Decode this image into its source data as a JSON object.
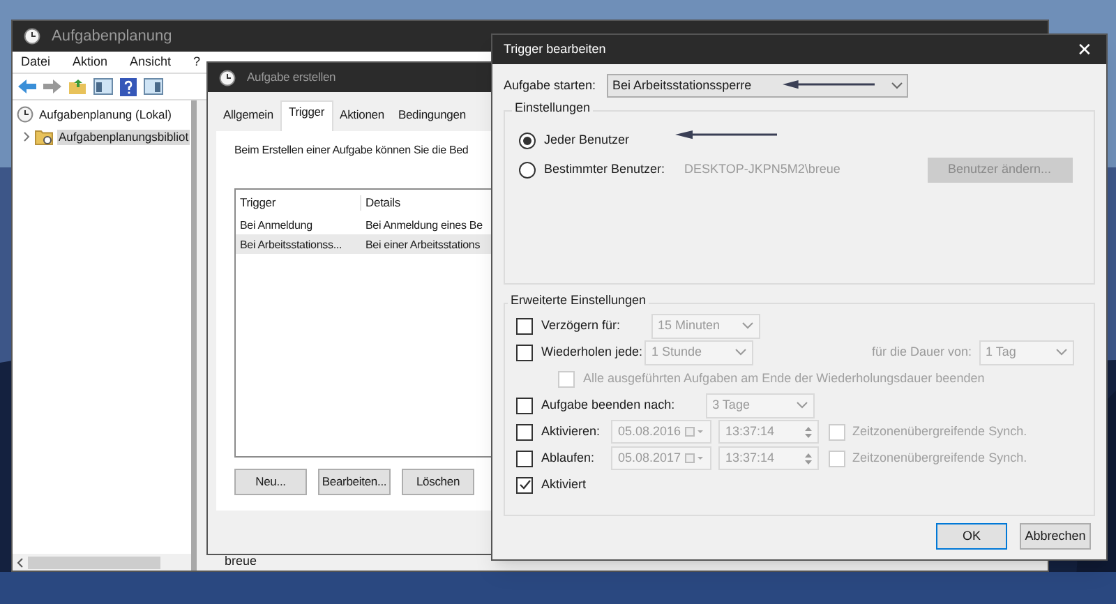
{
  "main_window": {
    "title": "Aufgabenplanung",
    "menu": [
      "Datei",
      "Aktion",
      "Ansicht",
      "?"
    ],
    "tree": [
      {
        "label": "Aufgabenplanung (Lokal)",
        "selected": false,
        "children": [
          {
            "label": "Aufgabenplanungsbibliot",
            "selected": true,
            "expanded": false
          }
        ]
      }
    ],
    "behind_text": "breue"
  },
  "create_dialog": {
    "title": "Aufgabe erstellen",
    "tabs": [
      {
        "label": "Allgemein",
        "selected": false
      },
      {
        "label": "Trigger",
        "selected": true
      },
      {
        "label": "Aktionen",
        "selected": false
      },
      {
        "label": "Bedingungen",
        "selected": false
      }
    ],
    "intro": "Beim Erstellen einer Aufgabe können Sie die Bed",
    "columns": [
      "Trigger",
      "Details"
    ],
    "rows": [
      {
        "cells": [
          "Bei Anmeldung",
          "Bei Anmeldung eines Be"
        ],
        "selected": false
      },
      {
        "cells": [
          "Bei Arbeitsstationss...",
          "Bei einer Arbeitsstations"
        ],
        "selected": true
      }
    ],
    "buttons": [
      "Neu...",
      "Bearbeiten...",
      "Löschen"
    ]
  },
  "trigger_dialog": {
    "title": "Trigger bearbeiten",
    "close": "✕",
    "start_label": "Aufgabe starten:",
    "start_value": "Bei Arbeitsstationssperre",
    "settings_title": "Einstellungen",
    "radios": [
      {
        "label": "Jeder Benutzer",
        "selected": true
      },
      {
        "label": "Bestimmter Benutzer:",
        "selected": false
      }
    ],
    "user_value": "DESKTOP-JKPN5M2\\breue",
    "change_user": {
      "label": "Benutzer ändern...",
      "disabled": true
    },
    "advanced_title": "Erweiterte Einstellungen",
    "rows": [
      {
        "kind": "combo",
        "label": "Verzögern für:",
        "checked": false,
        "value": "15 Minuten"
      },
      {
        "kind": "repeat",
        "label": "Wiederholen jede:",
        "checked": false,
        "value": "1 Stunde",
        "duration_label": "für die Dauer von:",
        "duration_value": "1 Tag"
      },
      {
        "kind": "sub",
        "label": "Alle ausgeführten Aufgaben am Ende der Wiederholungsdauer beenden",
        "checked": false
      },
      {
        "kind": "combo",
        "label": "Aufgabe beenden nach:",
        "checked": false,
        "value": "3 Tage"
      },
      {
        "kind": "datetime",
        "label": "Aktivieren:",
        "checked": false,
        "date": "05.08.2016",
        "time": "13:37:14",
        "sync_label": "Zeitzonenübergreifende Synch.",
        "sync_checked": false
      },
      {
        "kind": "datetime",
        "label": "Ablaufen:",
        "checked": false,
        "date": "05.08.2017",
        "time": "13:37:14",
        "sync_label": "Zeitzonenübergreifende Synch.",
        "sync_checked": false
      },
      {
        "kind": "check",
        "label": "Aktiviert",
        "checked": true
      }
    ],
    "buttons": [
      {
        "label": "OK",
        "default": true
      },
      {
        "label": "Abbrechen",
        "default": false
      }
    ]
  }
}
